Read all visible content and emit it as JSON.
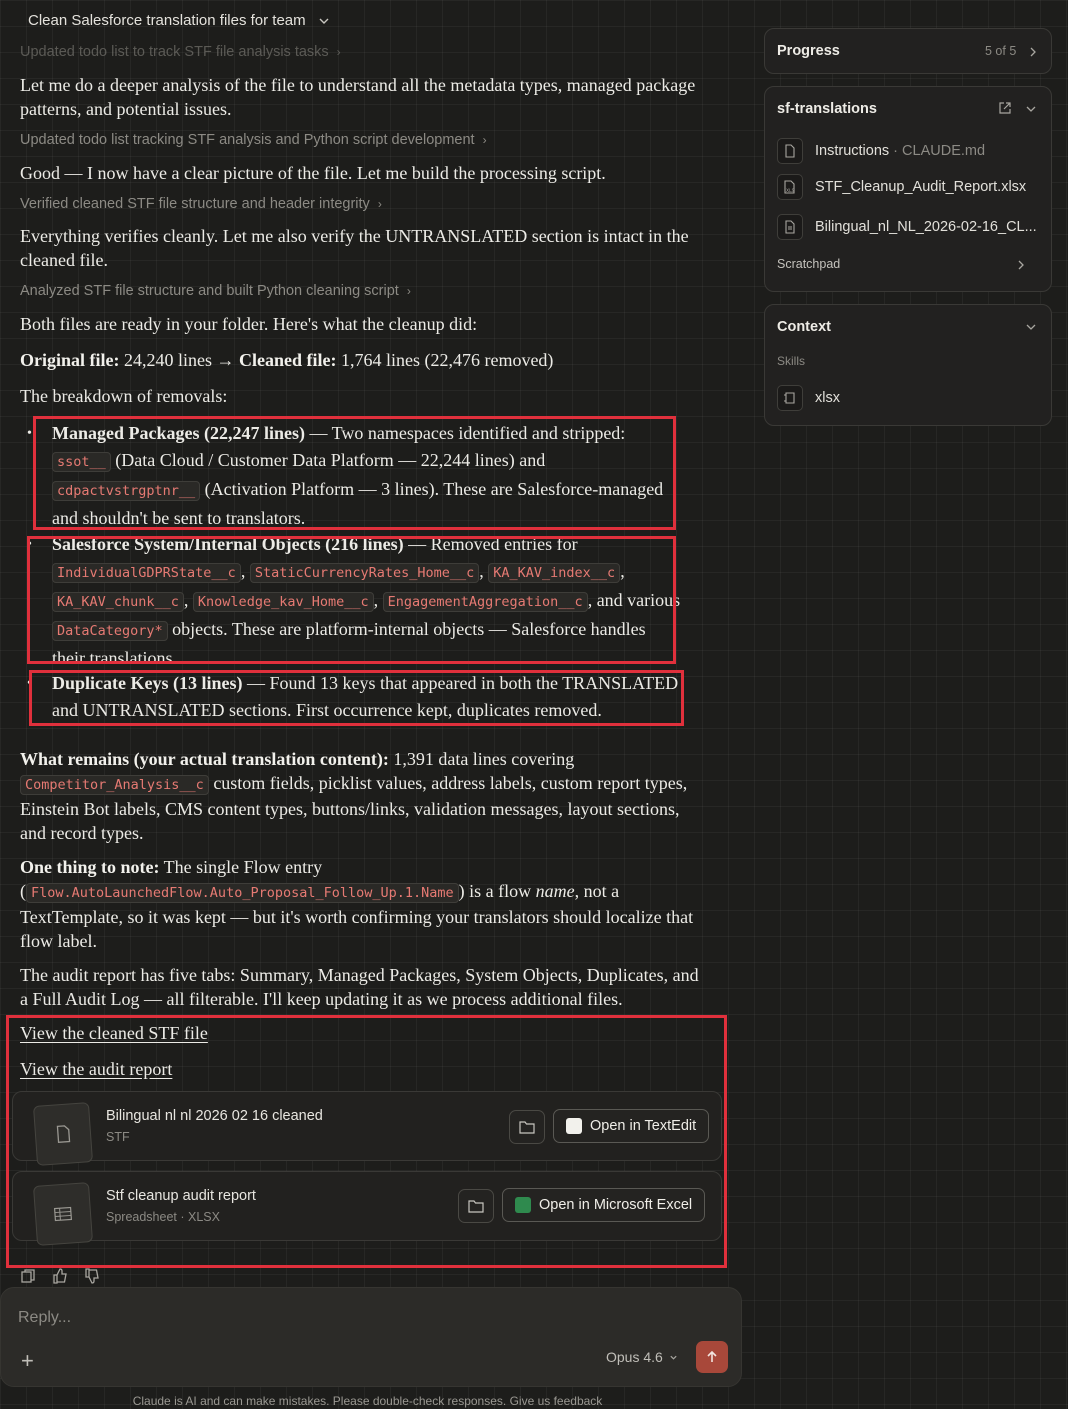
{
  "header": {
    "title": "Clean Salesforce translation files for team"
  },
  "steps": [
    "Updated todo list to track STF file analysis tasks",
    "Updated todo list tracking STF analysis and Python script development",
    "Verified cleaned STF file structure and header integrity",
    "Analyzed STF file structure and built Python cleaning script"
  ],
  "messages": {
    "p1": "Let me do a deeper analysis of the file to understand all the metadata types, managed package patterns, and potential issues.",
    "p2": "Good — I now have a clear picture of the file. Let me build the processing script.",
    "p3": "Everything verifies cleanly. Let me also verify the UNTRANSLATED section is intact in the cleaned file.",
    "p4": "Both files are ready in your folder. Here's what the cleanup did:",
    "p5_bold1": "Original file:",
    "p5_t1": " 24,240 lines → ",
    "p5_bold2": "Cleaned file:",
    "p5_t2": " 1,764 lines (22,476 removed)",
    "p6": "The breakdown of removals:"
  },
  "bullets": {
    "b1": {
      "bold": "Managed Packages (22,247 lines)",
      "t1": " — Two namespaces identified and stripped: ",
      "c1": "ssot__",
      "t2": " (Data Cloud / Customer Data Platform — 22,244 lines) and ",
      "c2": "cdpactvstrgptnr__",
      "t3": " (Activation Platform — 3 lines). These are Salesforce-managed and shouldn't be sent to translators."
    },
    "b2": {
      "bold": "Salesforce System/Internal Objects (216 lines)",
      "t1": " — Removed entries for ",
      "c1": "IndividualGDPRState__c",
      "c2": "StaticCurrencyRates_Home__c",
      "c3": "KA_KAV_index__c",
      "c4": "KA_KAV_chunk__c",
      "c5": "Knowledge_kav_Home__c",
      "c6": "EngagementAggregation__c",
      "t2": ", and various ",
      "c7": "DataCategory*",
      "t3": " objects. These are platform-internal objects — Salesforce handles their translations."
    },
    "b3": {
      "bold": "Duplicate Keys (13 lines)",
      "t1": " — Found 13 keys that appeared in both the TRANSLATED and UNTRANSLATED sections. First occurrence kept, duplicates removed."
    }
  },
  "remains": {
    "bold": "What remains (your actual translation content):",
    "t1": " 1,391 data lines covering ",
    "code": "Competitor_Analysis__c",
    "t2": " custom fields, picklist values, address labels, custom report types, Einstein Bot labels, CMS content types, buttons/links, validation messages, layout sections, and record types."
  },
  "note": {
    "bold": "One thing to note:",
    "t1": " The single Flow entry (",
    "code": "Flow.AutoLaunchedFlow.Auto_Proposal_Follow_Up.1.Name",
    "t2": ") is a flow ",
    "em": "name",
    "t3": ", not a TextTemplate, so it was kept — but it's worth confirming your translators should localize that flow label."
  },
  "audit_text": "The audit report has five tabs: Summary, Managed Packages, System Objects, Duplicates, and a Full Audit Log — all filterable. I'll keep updating it as we process additional files.",
  "links": {
    "stf": "View the cleaned STF file",
    "audit": "View the audit report"
  },
  "files": [
    {
      "name": "Bilingual nl nl 2026 02 16 cleaned",
      "type": "STF",
      "open_label": "Open in TextEdit"
    },
    {
      "name": "Stf cleanup audit report",
      "type": "Spreadsheet · XLSX",
      "open_label": "Open in Microsoft Excel"
    }
  ],
  "reply": {
    "placeholder": "Reply...",
    "model": "Opus 4.6"
  },
  "footer": "Claude is AI and can make mistakes. Please double-check responses. Give us feedback",
  "sidebar": {
    "progress": {
      "title": "Progress",
      "count": "5 of 5"
    },
    "folder": {
      "title": "sf-translations",
      "items": [
        {
          "name": "Instructions",
          "suffix": " · CLAUDE.md",
          "icon": "doc-icon"
        },
        {
          "name": "STF_Cleanup_Audit_Report.xlsx",
          "suffix": "",
          "icon": "xls-icon"
        },
        {
          "name": "Bilingual_nl_NL_2026-02-16_CL...",
          "suffix": "",
          "icon": "doc-icon"
        }
      ],
      "scratchpad": "Scratchpad"
    },
    "context": {
      "title": "Context",
      "skills_label": "Skills",
      "skill": "xlsx"
    }
  },
  "colors": {
    "accent_red": "#e0303c",
    "code_text": "#e67a73",
    "send_button": "#a8483a"
  }
}
